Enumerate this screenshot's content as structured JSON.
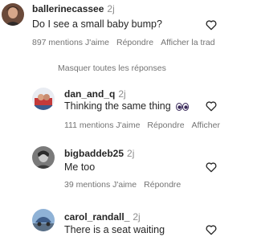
{
  "comments": [
    {
      "username": "ballerinecassee",
      "age": "2j",
      "text": "Do I see a small baby bump?",
      "likes": "897 mentions J'aime",
      "reply": "Répondre",
      "translate": "Afficher la trad"
    },
    {
      "username": "dan_and_q",
      "age": "2j",
      "text": "Thinking the same thing",
      "likes": "111 mentions J'aime",
      "reply": "Répondre",
      "translate": "Afficher"
    },
    {
      "username": "bigbaddeb25",
      "age": "2j",
      "text": "Me too",
      "likes": "39 mentions J'aime",
      "reply": "Répondre"
    },
    {
      "username": "carol_randall_",
      "age": "2j",
      "text": "There is a seat waiting"
    }
  ],
  "hide_replies": "Masquer toutes les réponses"
}
